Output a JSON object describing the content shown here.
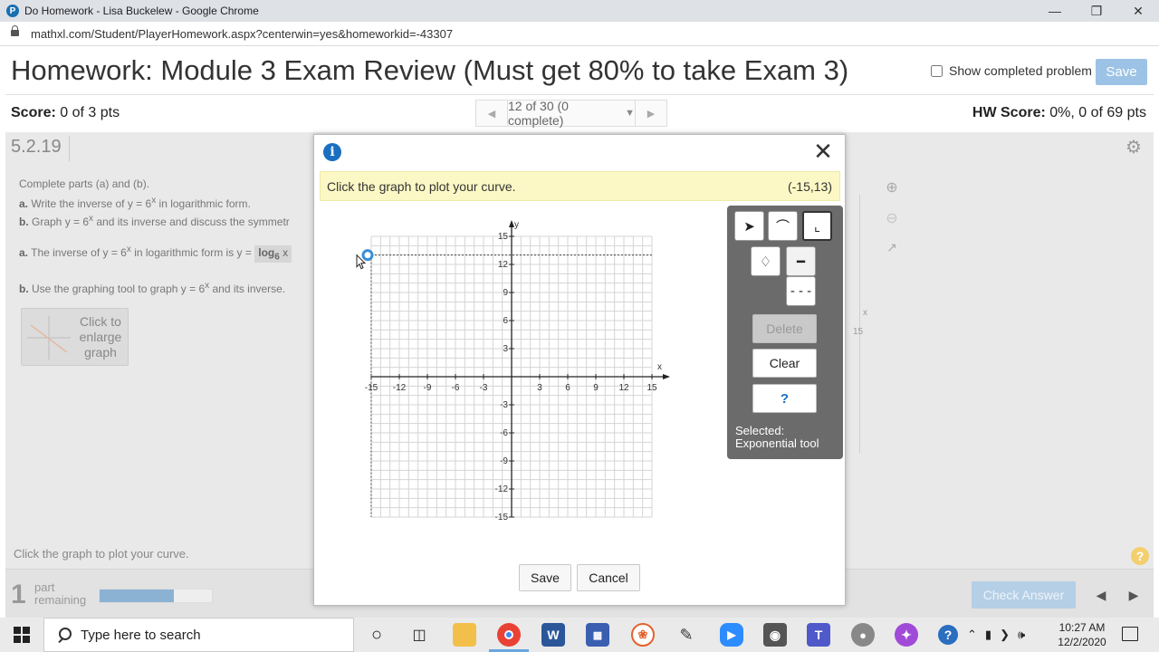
{
  "window": {
    "title": "Do Homework - Lisa Buckelew - Google Chrome",
    "url": "mathxl.com/Student/PlayerHomework.aspx?centerwin=yes&homeworkid=-43307",
    "minimize": "—",
    "restore": "❐",
    "close": "✕"
  },
  "header": {
    "title": "Homework: Module 3 Exam Review (Must get 80% to take Exam 3)",
    "show_completed_label": "Show completed problem",
    "save_label": "Save"
  },
  "scorebar": {
    "score_label": "Score:",
    "score_value": " 0 of 3 pts",
    "pager_text": "12 of 30 (0 complete)",
    "hw_score_label": "HW Score:",
    "hw_score_value": " 0%, 0 of 69 pts"
  },
  "question": {
    "number": "5.2.19",
    "intro": "Complete parts (a) and (b).",
    "part_a_label": "a.",
    "part_a_text": " Write the inverse of y = 6",
    "part_a_tail": " in logarithmic form.",
    "part_b_label": "b.",
    "part_b_text": " Graph y = 6",
    "part_b_tail": " and its inverse and discuss the symmetr",
    "answer_a_label": "a.",
    "answer_a_text": " The inverse of y = 6",
    "answer_a_mid": " in logarithmic form is y = ",
    "answer_log": "log",
    "answer_base": "6",
    "answer_var": "x",
    "answer_b_label": "b.",
    "answer_b_text": " Use the graphing tool to graph y = 6",
    "answer_b_tail": " and its inverse.",
    "exp_x": "x",
    "enlarge_label": "Click to enlarge graph",
    "bg_axis_x": "x",
    "bg_tick": "15",
    "bottom_note": "Click the graph to plot your curve.",
    "help_icon": "?"
  },
  "footer": {
    "parts_count": "1",
    "parts_label": "part remaining",
    "progress_fraction": 0.66,
    "check_answer_label": "Check Answer"
  },
  "dialog": {
    "info_icon": "i",
    "close_icon": "✕",
    "prompt": "Click the graph to plot your curve.",
    "coord": "(-15,13)",
    "toolbox": {
      "delete_label": "Delete",
      "clear_label": "Clear",
      "help_label": "?",
      "selected_label": "Selected:",
      "selected_tool": "Exponential tool"
    },
    "save_label": "Save",
    "cancel_label": "Cancel"
  },
  "graph": {
    "x_axis_label": "x",
    "y_axis_label": "y",
    "x_ticks": [
      "-15",
      "-12",
      "-9",
      "-6",
      "-3",
      "3",
      "6",
      "9",
      "12",
      "15"
    ],
    "x_tick_values": [
      -15,
      -12,
      -9,
      -6,
      -3,
      3,
      6,
      9,
      12,
      15
    ],
    "y_ticks": [
      "15",
      "12",
      "9",
      "6",
      "3",
      "-3",
      "-6",
      "-9",
      "-12",
      "-15"
    ],
    "y_tick_values": [
      15,
      12,
      9,
      6,
      3,
      -3,
      -6,
      -9,
      -12,
      -15
    ],
    "range": [
      -15,
      15
    ],
    "cursor_point": [
      -15,
      13
    ]
  },
  "taskbar": {
    "search_placeholder": "Type here to search",
    "time": "10:27 AM",
    "date": "12/2/2020"
  }
}
